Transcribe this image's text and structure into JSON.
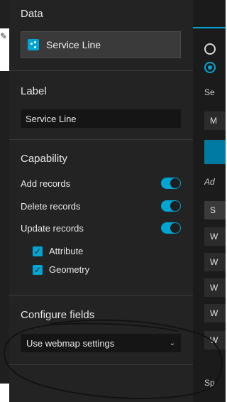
{
  "panel": {
    "data_section": {
      "title": "Data",
      "layer_name": "Service Line",
      "layer_icon": "point-layer-icon"
    },
    "label_section": {
      "title": "Label",
      "value": "Service Line"
    },
    "capability_section": {
      "title": "Capability",
      "toggles": [
        {
          "label": "Add records",
          "on": true
        },
        {
          "label": "Delete records",
          "on": true
        },
        {
          "label": "Update records",
          "on": true
        }
      ],
      "checkboxes": [
        {
          "label": "Attribute",
          "checked": true
        },
        {
          "label": "Geometry",
          "checked": true
        }
      ]
    },
    "configure_fields_section": {
      "title": "Configure fields",
      "selected_option": "Use webmap settings"
    }
  },
  "right_panel": {
    "text1": "Se",
    "box1": "M",
    "text2": "Ad",
    "box2": "S",
    "rows": [
      "W",
      "W",
      "W",
      "W",
      "W"
    ],
    "bottom_text": "Sp"
  },
  "colors": {
    "accent": "#00a5d3",
    "panel_bg": "#232323",
    "input_bg": "#151515"
  }
}
